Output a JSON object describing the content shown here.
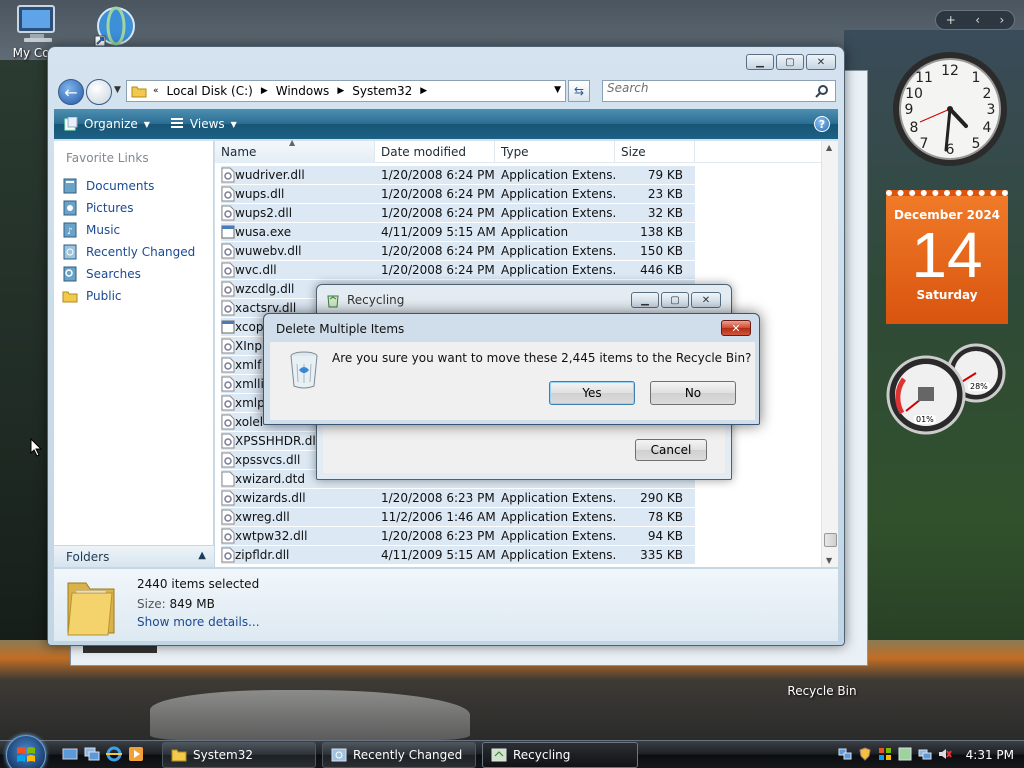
{
  "desktop": {
    "icons": [
      {
        "label": "My Com"
      },
      {
        "label": ""
      },
      {
        "label": "Recycle Bin"
      }
    ]
  },
  "gadgets": {
    "calendar": {
      "month": "December 2024",
      "day": "14",
      "weekday": "Saturday"
    },
    "meters": {
      "cpu": "01%",
      "memory": "28%"
    }
  },
  "explorer": {
    "breadcrumb": [
      "Local Disk (C:)",
      "Windows",
      "System32"
    ],
    "breadcrumb_prefix": "«",
    "search_placeholder": "Search",
    "toolbar": {
      "organize": "Organize",
      "views": "Views",
      "help": "?"
    },
    "nav": {
      "title": "Favorite Links",
      "links": [
        "Documents",
        "Pictures",
        "Music",
        "Recently Changed",
        "Searches",
        "Public"
      ],
      "folders_label": "Folders"
    },
    "columns": {
      "name": "Name",
      "date": "Date modified",
      "type": "Type",
      "size": "Size"
    },
    "files": [
      {
        "name": "wudriver.dll",
        "date": "1/20/2008 6:24 PM",
        "type": "Application Extens...",
        "size": "79 KB",
        "icon": "dll"
      },
      {
        "name": "wups.dll",
        "date": "1/20/2008 6:24 PM",
        "type": "Application Extens...",
        "size": "23 KB",
        "icon": "dll"
      },
      {
        "name": "wups2.dll",
        "date": "1/20/2008 6:24 PM",
        "type": "Application Extens...",
        "size": "32 KB",
        "icon": "dll"
      },
      {
        "name": "wusa.exe",
        "date": "4/11/2009 5:15 AM",
        "type": "Application",
        "size": "138 KB",
        "icon": "exe"
      },
      {
        "name": "wuwebv.dll",
        "date": "1/20/2008 6:24 PM",
        "type": "Application Extens...",
        "size": "150 KB",
        "icon": "dll"
      },
      {
        "name": "wvc.dll",
        "date": "1/20/2008 6:24 PM",
        "type": "Application Extens...",
        "size": "446 KB",
        "icon": "dll"
      },
      {
        "name": "wzcdlg.dll",
        "date": "",
        "type": "",
        "size": "",
        "icon": "dll"
      },
      {
        "name": "xactsrv.dll",
        "date": "",
        "type": "",
        "size": "",
        "icon": "dll"
      },
      {
        "name": "xcop",
        "date": "",
        "type": "",
        "size": "",
        "icon": "exe"
      },
      {
        "name": "XInp",
        "date": "",
        "type": "",
        "size": "",
        "icon": "dll"
      },
      {
        "name": "xmlf",
        "date": "",
        "type": "",
        "size": "",
        "icon": "dll"
      },
      {
        "name": "xmlli",
        "date": "",
        "type": "",
        "size": "",
        "icon": "dll"
      },
      {
        "name": "xmlp",
        "date": "",
        "type": "",
        "size": "",
        "icon": "dll"
      },
      {
        "name": "xolel",
        "date": "",
        "type": "",
        "size": "",
        "icon": "dll"
      },
      {
        "name": "XPSSHHDR.dll",
        "date": "",
        "type": "",
        "size": "",
        "icon": "dll"
      },
      {
        "name": "xpssvcs.dll",
        "date": "",
        "type": "",
        "size": "",
        "icon": "dll"
      },
      {
        "name": "xwizard.dtd",
        "date": "",
        "type": "",
        "size": "",
        "icon": "file"
      },
      {
        "name": "xwizards.dll",
        "date": "1/20/2008 6:23 PM",
        "type": "Application Extens...",
        "size": "290 KB",
        "icon": "dll"
      },
      {
        "name": "xwreg.dll",
        "date": "11/2/2006 1:46 AM",
        "type": "Application Extens...",
        "size": "78 KB",
        "icon": "dll"
      },
      {
        "name": "xwtpw32.dll",
        "date": "1/20/2008 6:23 PM",
        "type": "Application Extens...",
        "size": "94 KB",
        "icon": "dll"
      },
      {
        "name": "zipfldr.dll",
        "date": "4/11/2009 5:15 AM",
        "type": "Application Extens...",
        "size": "335 KB",
        "icon": "dll"
      }
    ],
    "details": {
      "selected": "2440 items selected",
      "size_label": "Size:",
      "size_value": "849 MB",
      "more": "Show more details..."
    }
  },
  "recycling": {
    "title": "Recycling",
    "cancel": "Cancel"
  },
  "dialog": {
    "title": "Delete Multiple Items",
    "message": "Are you sure you want to move these 2,445 items to the Recycle Bin?",
    "yes": "Yes",
    "no": "No",
    "close": "✕"
  },
  "taskbar": {
    "tasks": [
      {
        "label": "System32",
        "icon": "folder"
      },
      {
        "label": "Recently Changed",
        "icon": "search"
      },
      {
        "label": "Recycling",
        "icon": "recycle"
      }
    ],
    "clock": "4:31 PM"
  },
  "colors": {
    "accent": "#1a4a93",
    "toolbar": "#1d6185",
    "calendar": "#e46218",
    "selection": "#dce8f4"
  }
}
